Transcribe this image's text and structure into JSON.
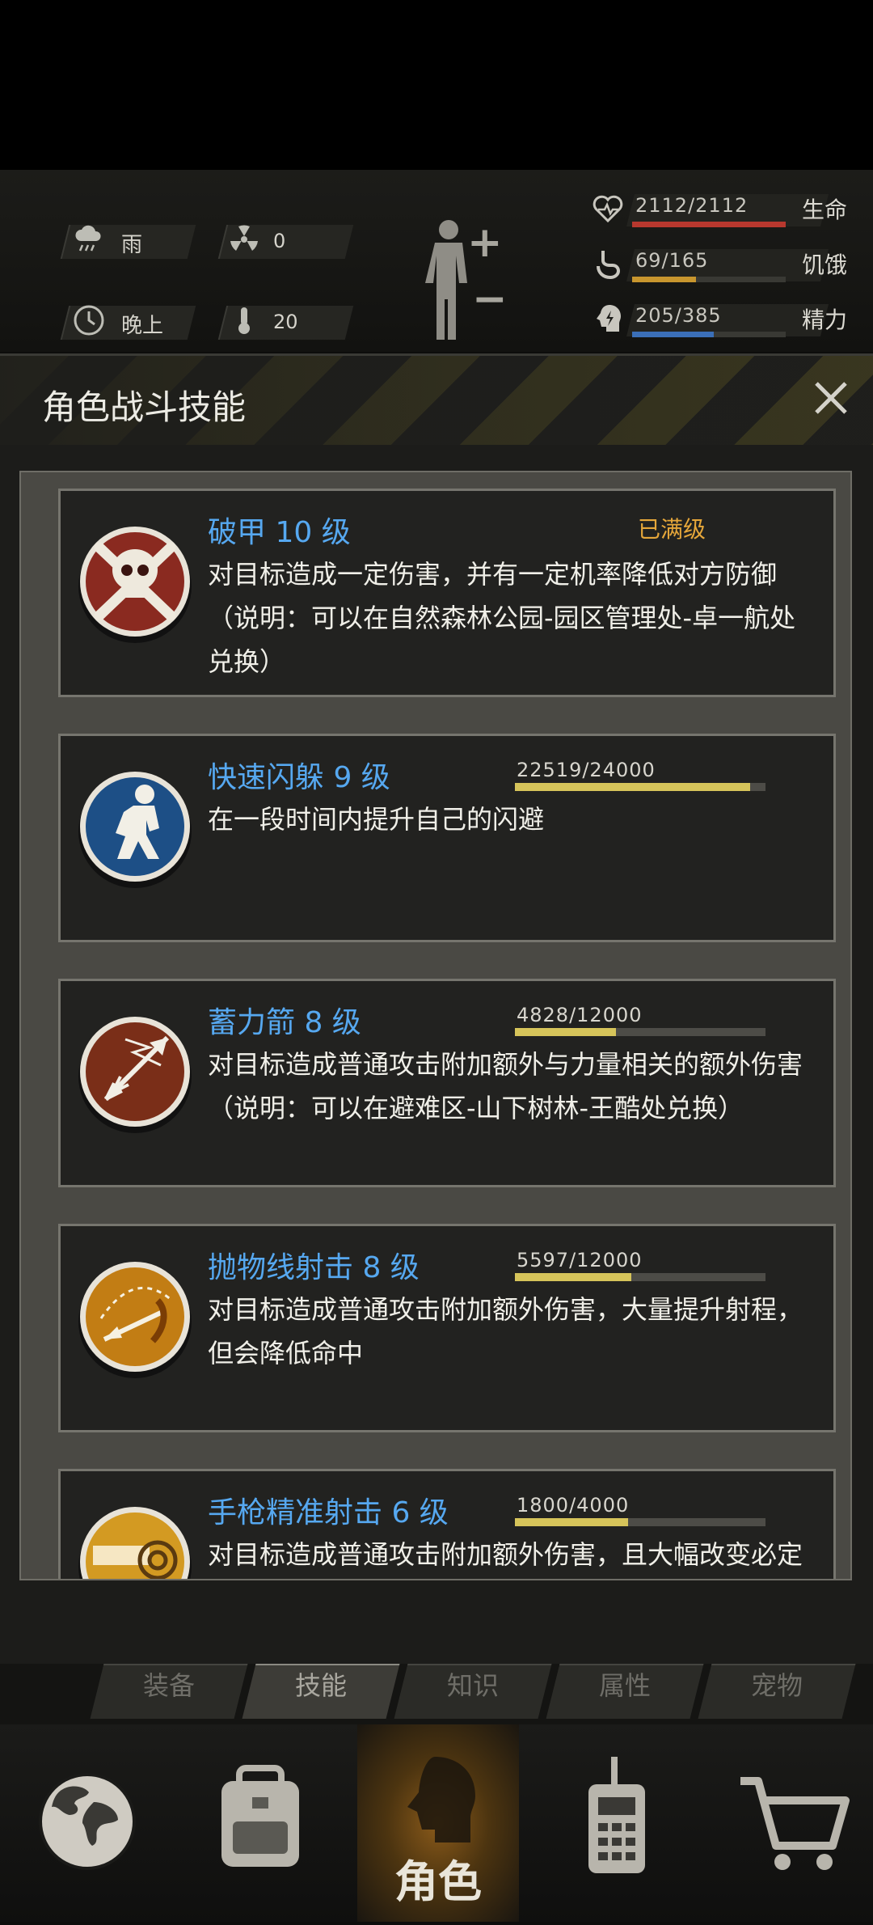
{
  "status": {
    "weather": {
      "icon": "rain-cloud-icon",
      "label": "雨"
    },
    "radiation": {
      "icon": "radiation-icon",
      "value": "0"
    },
    "time": {
      "icon": "clock-icon",
      "label": "晚上"
    },
    "temperature": {
      "icon": "thermometer-icon",
      "value": "20"
    },
    "vitals": [
      {
        "icon": "heart-icon",
        "value": "2112/2112",
        "label": "生命",
        "fraction": 1.0,
        "color": "#b8382e"
      },
      {
        "icon": "stomach-icon",
        "value": "69/165",
        "label": "饥饿",
        "fraction": 0.418,
        "color": "#c8962e"
      },
      {
        "icon": "energy-head-icon",
        "value": "205/385",
        "label": "精力",
        "fraction": 0.532,
        "color": "#3b6fb8"
      }
    ]
  },
  "dialog": {
    "title": "角色战斗技能",
    "close_label": "✕",
    "skills": [
      {
        "name": "破甲 10 级",
        "status": "已满级",
        "progress_text": "",
        "progress": null,
        "description": "对目标造成一定伤害，并有一定机率降低对方防御（说明：可以在自然森林公园-园区管理处-卓一航处兑换）",
        "icon": "skull-crossbones-icon"
      },
      {
        "name": "快速闪躲 9 级",
        "status": "",
        "progress_text": "22519/24000",
        "progress": 0.938,
        "description": "在一段时间内提升自己的闪避",
        "icon": "dodge-kneel-icon"
      },
      {
        "name": "蓄力箭 8 级",
        "status": "",
        "progress_text": "4828/12000",
        "progress": 0.402,
        "description": "对目标造成普通攻击附加额外与力量相关的额外伤害（说明：可以在避难区-山下树林-王酷处兑换）",
        "icon": "charged-arrow-icon"
      },
      {
        "name": "抛物线射击 8 级",
        "status": "",
        "progress_text": "5597/12000",
        "progress": 0.466,
        "description": "对目标造成普通攻击附加额外伤害，大量提升射程，但会降低命中",
        "icon": "parabolic-arrow-icon"
      },
      {
        "name": "手枪精准射击 6 级",
        "status": "",
        "progress_text": "1800/4000",
        "progress": 0.45,
        "description": "对目标造成普通攻击附加额外伤害，且大幅改变必定",
        "icon": "pistol-target-icon"
      }
    ]
  },
  "subtabs": [
    {
      "label": "装备",
      "active": false
    },
    {
      "label": "技能",
      "active": true
    },
    {
      "label": "知识",
      "active": false
    },
    {
      "label": "属性",
      "active": false
    },
    {
      "label": "宠物",
      "active": false
    }
  ],
  "nav": {
    "items": [
      {
        "icon": "globe-icon",
        "label": ""
      },
      {
        "icon": "backpack-icon",
        "label": ""
      },
      {
        "icon": "character-head-icon",
        "label": "角色"
      },
      {
        "icon": "walkie-talkie-icon",
        "label": ""
      },
      {
        "icon": "shopping-cart-icon",
        "label": ""
      }
    ]
  }
}
